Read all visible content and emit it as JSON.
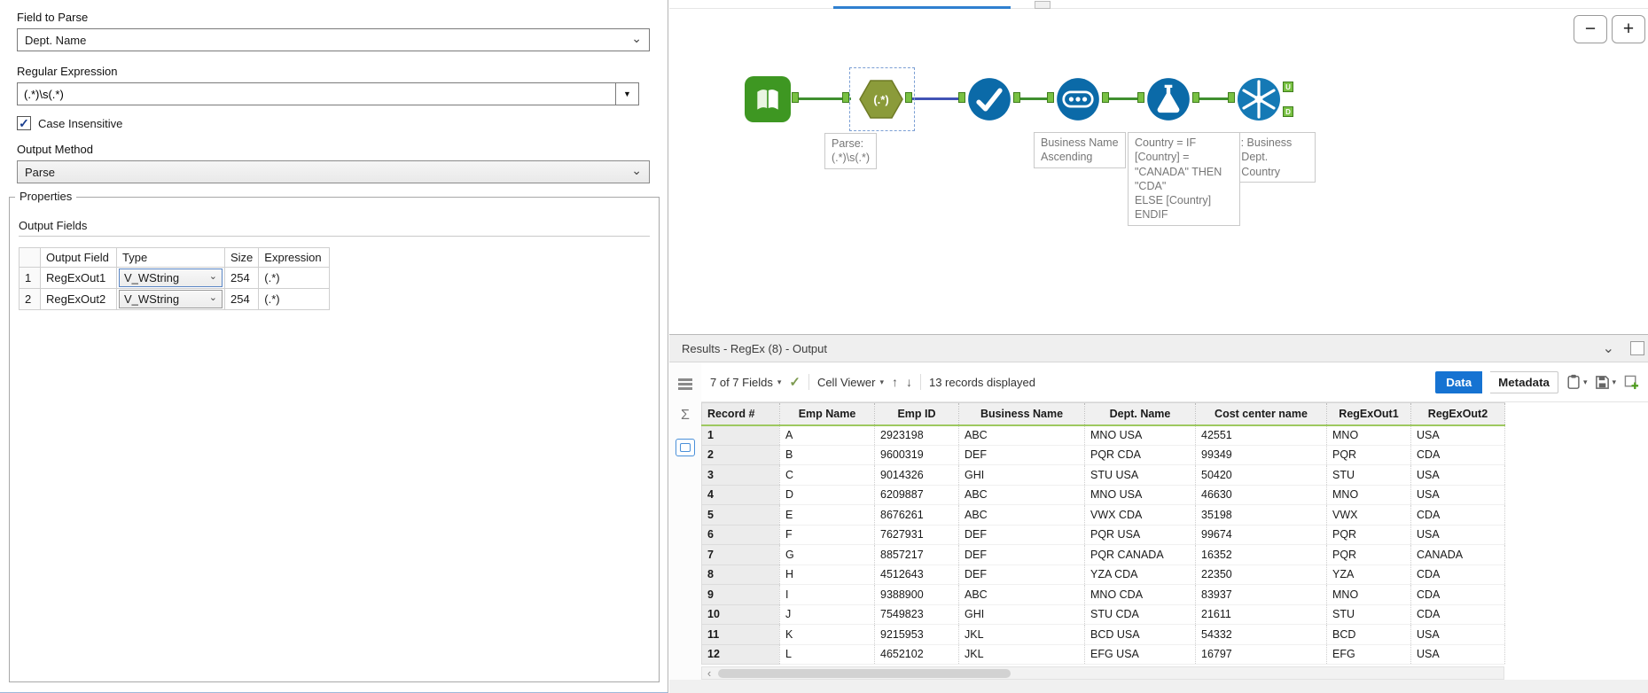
{
  "icons": {
    "check": "✓",
    "chevron_down": "⌄",
    "dropdown_triangle": "▼",
    "small_triangle": "▾",
    "up_arrow": "↑",
    "down_arrow": "↓",
    "zoom_minus": "−",
    "zoom_plus": "+",
    "scroll_left": "‹",
    "sigma": "Σ"
  },
  "config": {
    "field_to_parse_label": "Field to Parse",
    "field_to_parse_value": "Dept. Name",
    "regex_label": "Regular Expression",
    "regex_value": "(.*)\\s(.*)",
    "case_insensitive_label": "Case Insensitive",
    "output_method_label": "Output Method",
    "output_method_value": "Parse",
    "properties_label": "Properties",
    "output_fields_label": "Output Fields",
    "fields_table": {
      "col_output_field": "Output Field",
      "col_type": "Type",
      "col_size": "Size",
      "col_expression": "Expression",
      "rows": [
        {
          "num": "1",
          "field": "RegExOut1",
          "type": "V_WString",
          "size": "254",
          "expr": "(.*)"
        },
        {
          "num": "2",
          "field": "RegExOut2",
          "type": "V_WString",
          "size": "254",
          "expr": "(.*)"
        }
      ]
    }
  },
  "canvas": {
    "regex_tool_label": "(.*)",
    "unique_output_u": "U",
    "unique_output_d": "D",
    "annotations": {
      "parse": "Parse:\n(.*)\\s(.*)",
      "sort": "Business Name\nAscending",
      "formula": "Country = IF\n[Country] =\n\"CANADA\" THEN\n\"CDA\"\nELSE [Country]\nENDIF",
      "unique": "Unique: Business\nName, Dept.\nName, Country"
    }
  },
  "results": {
    "title": "Results - RegEx (8) - Output",
    "fields_dropdown": "7 of 7 Fields",
    "cell_viewer_label": "Cell Viewer",
    "records_label": "13 records displayed",
    "data_button": "Data",
    "metadata_button": "Metadata",
    "grid": {
      "headers": [
        "Record #",
        "Emp Name",
        "Emp ID",
        "Business Name",
        "Dept. Name",
        "Cost center name",
        "RegExOut1",
        "RegExOut2"
      ],
      "rows": [
        [
          "1",
          "A",
          "2923198",
          "ABC",
          "MNO USA",
          "42551",
          "MNO",
          "USA"
        ],
        [
          "2",
          "B",
          "9600319",
          "DEF",
          "PQR CDA",
          "99349",
          "PQR",
          "CDA"
        ],
        [
          "3",
          "C",
          "9014326",
          "GHI",
          "STU USA",
          "50420",
          "STU",
          "USA"
        ],
        [
          "4",
          "D",
          "6209887",
          "ABC",
          "MNO USA",
          "46630",
          "MNO",
          "USA"
        ],
        [
          "5",
          "E",
          "8676261",
          "ABC",
          "VWX CDA",
          "35198",
          "VWX",
          "CDA"
        ],
        [
          "6",
          "F",
          "7627931",
          "DEF",
          "PQR USA",
          "99674",
          "PQR",
          "USA"
        ],
        [
          "7",
          "G",
          "8857217",
          "DEF",
          "PQR CANADA",
          "16352",
          "PQR",
          "CANADA"
        ],
        [
          "8",
          "H",
          "4512643",
          "DEF",
          "YZA CDA",
          "22350",
          "YZA",
          "CDA"
        ],
        [
          "9",
          "I",
          "9388900",
          "ABC",
          "MNO CDA",
          "83937",
          "MNO",
          "CDA"
        ],
        [
          "10",
          "J",
          "7549823",
          "GHI",
          "STU CDA",
          "21611",
          "STU",
          "CDA"
        ],
        [
          "11",
          "K",
          "9215953",
          "JKL",
          "BCD USA",
          "54332",
          "BCD",
          "USA"
        ],
        [
          "12",
          "L",
          "4652102",
          "JKL",
          "EFG USA",
          "16797",
          "EFG",
          "USA"
        ]
      ]
    }
  }
}
